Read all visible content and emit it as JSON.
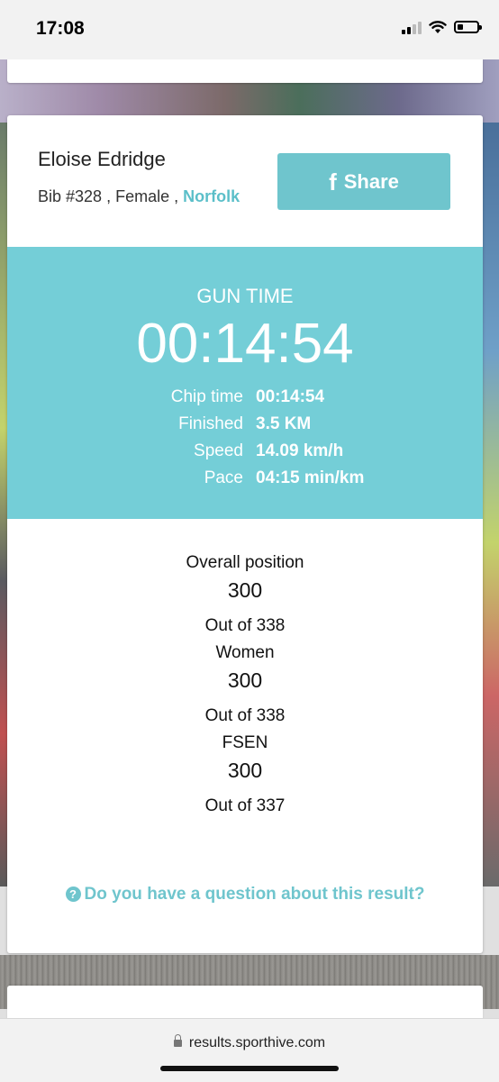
{
  "status_bar": {
    "time": "17:08"
  },
  "athlete": {
    "name": "Eloise Edridge",
    "bib": "Bib #328",
    "gender": "Female",
    "region": "Norfolk",
    "separator": " , "
  },
  "share": {
    "label": "Share",
    "icon": "facebook-icon"
  },
  "times": {
    "gun_label": "GUN TIME",
    "gun_time": "00:14:54",
    "stats": [
      {
        "label": "Chip time",
        "value": "00:14:54"
      },
      {
        "label": "Finished",
        "value": "3.5 KM"
      },
      {
        "label": "Speed",
        "value": "14.09 km/h"
      },
      {
        "label": "Pace",
        "value": "04:15 min/km"
      }
    ]
  },
  "positions": [
    {
      "category": "Overall position",
      "position": "300",
      "out_of": "Out of 338"
    },
    {
      "category": "Women",
      "position": "300",
      "out_of": "Out of 338"
    },
    {
      "category": "FSEN",
      "position": "300",
      "out_of": "Out of 337"
    }
  ],
  "question": {
    "label": "Do you have a question about this result?"
  },
  "browser": {
    "url": "results.sporthive.com"
  },
  "colors": {
    "accent": "#74ced7",
    "button": "#6fc5cd",
    "link": "#5bbfc9"
  }
}
